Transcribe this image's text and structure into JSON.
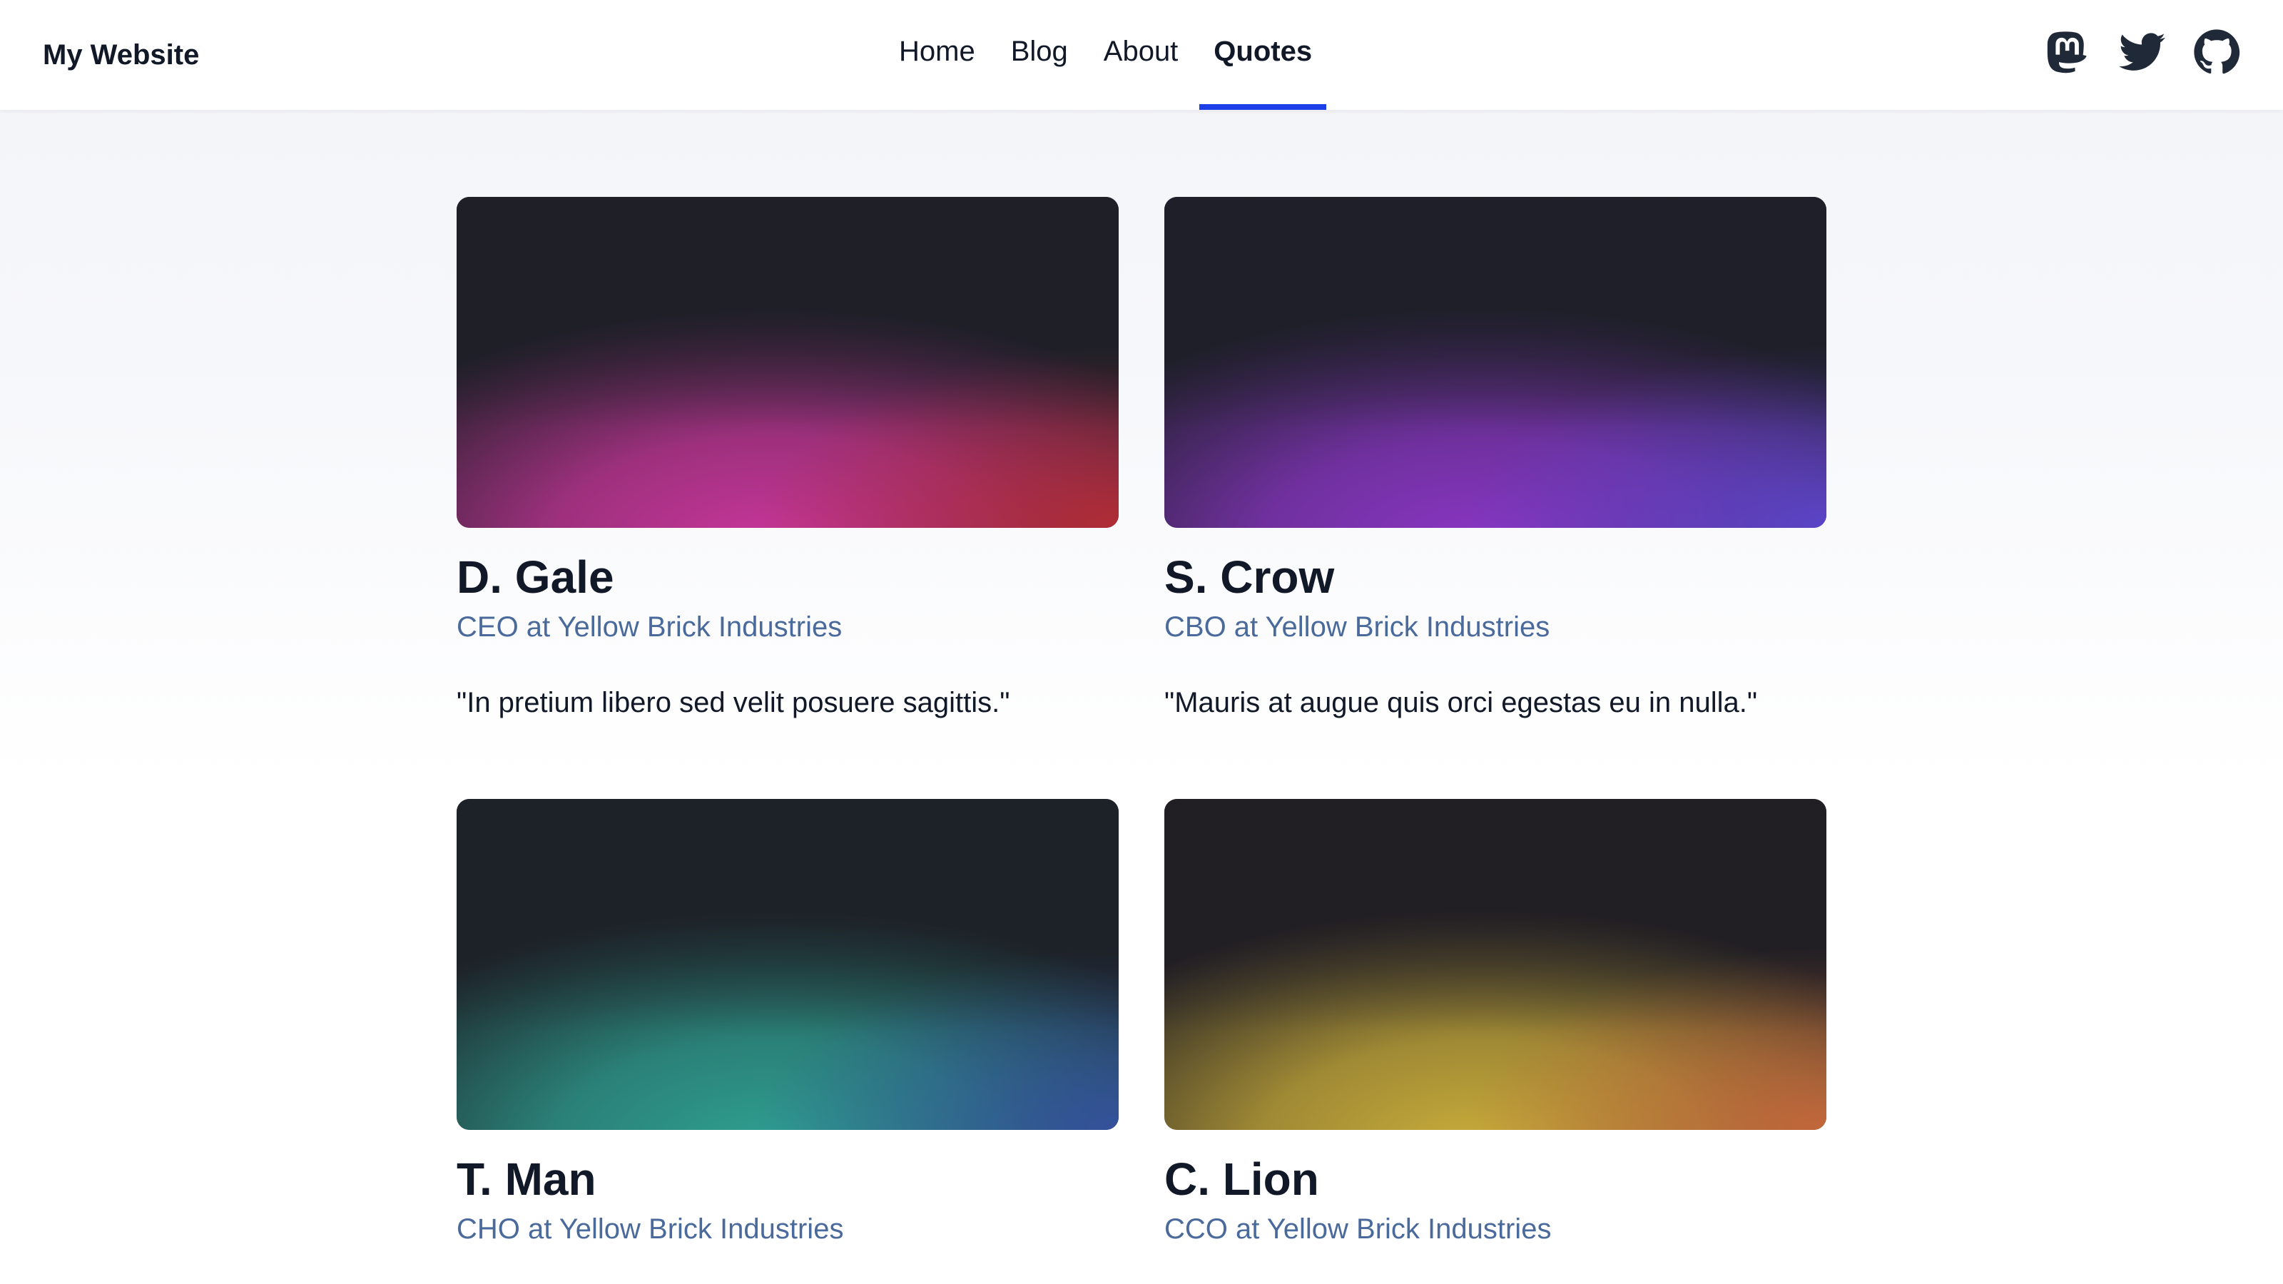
{
  "header": {
    "brand": "My Website",
    "nav": [
      {
        "label": "Home",
        "active": false
      },
      {
        "label": "Blog",
        "active": false
      },
      {
        "label": "About",
        "active": false
      },
      {
        "label": "Quotes",
        "active": true
      }
    ],
    "social_icons": [
      "mastodon-icon",
      "twitter-icon",
      "github-icon"
    ],
    "accent_color": "#1d3fe8"
  },
  "cards": [
    {
      "name": "D. Gale",
      "role": "CEO at Yellow Brick Industries",
      "quote": "\"In pretium libero sed velit posuere sagittis.\"",
      "gradient": {
        "top": "#1f1f28",
        "glow": "#c8369a",
        "corner": "#b12c34"
      }
    },
    {
      "name": "S. Crow",
      "role": "CBO at Yellow Brick Industries",
      "quote": "\"Mauris at augue quis orci egestas eu in nulla.\"",
      "gradient": {
        "top": "#1f1f2a",
        "glow": "#8a36c4",
        "corner": "#5b45c8"
      }
    },
    {
      "name": "T. Man",
      "role": "CHO at Yellow Brick Industries",
      "quote": "",
      "gradient": {
        "top": "#1d2228",
        "glow": "#2fa092",
        "corner": "#34519c"
      }
    },
    {
      "name": "C. Lion",
      "role": "CCO at Yellow Brick Industries",
      "quote": "",
      "gradient": {
        "top": "#221f24",
        "glow": "#c9ad3a",
        "corner": "#c4673c"
      }
    }
  ]
}
